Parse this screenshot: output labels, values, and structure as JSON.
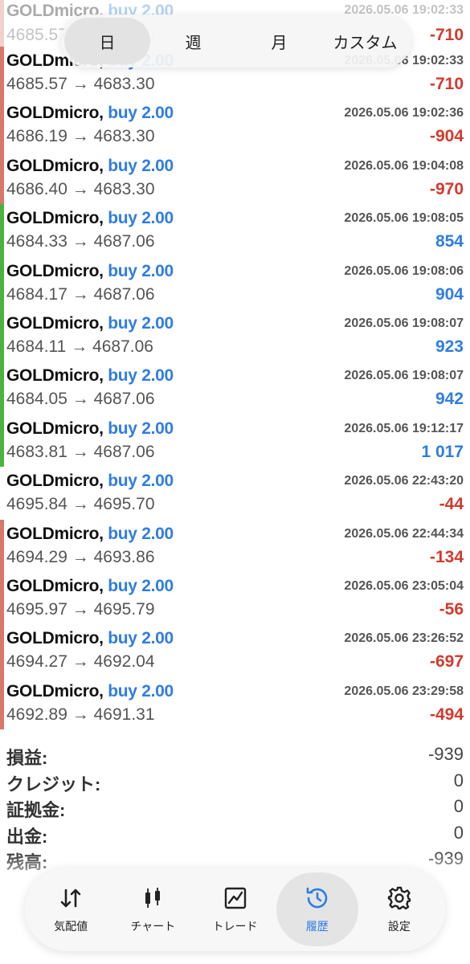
{
  "period_tabs": [
    {
      "label": "日",
      "active": true
    },
    {
      "label": "週",
      "active": false
    },
    {
      "label": "月",
      "active": false
    },
    {
      "label": "カスタム",
      "active": false
    }
  ],
  "deals": [
    {
      "symbol": "GOLDmicro,",
      "side": "buy 2.00",
      "time": "2026.05.06 19:02:33",
      "open": "4685.57",
      "arrow": "→",
      "close": "4683.30",
      "profit": "-710",
      "sign": "neg",
      "bar_color": "#d9776c"
    },
    {
      "symbol": "GOLDmicro,",
      "side": "buy 2.00",
      "time": "2026.05.06 19:02:33",
      "open": "4685.57",
      "arrow": "→",
      "close": "4683.30",
      "profit": "-710",
      "sign": "neg",
      "bar_color": "#d9776c"
    },
    {
      "symbol": "GOLDmicro,",
      "side": "buy 2.00",
      "time": "2026.05.06 19:02:36",
      "open": "4686.19",
      "arrow": "→",
      "close": "4683.30",
      "profit": "-904",
      "sign": "neg",
      "bar_color": "#d9776c"
    },
    {
      "symbol": "GOLDmicro,",
      "side": "buy 2.00",
      "time": "2026.05.06 19:04:08",
      "open": "4686.40",
      "arrow": "→",
      "close": "4683.30",
      "profit": "-970",
      "sign": "neg",
      "bar_color": "#d9776c"
    },
    {
      "symbol": "GOLDmicro,",
      "side": "buy 2.00",
      "time": "2026.05.06 19:08:05",
      "open": "4684.33",
      "arrow": "→",
      "close": "4687.06",
      "profit": "854",
      "sign": "pos",
      "bar_color": "#49b43c"
    },
    {
      "symbol": "GOLDmicro,",
      "side": "buy 2.00",
      "time": "2026.05.06 19:08:06",
      "open": "4684.17",
      "arrow": "→",
      "close": "4687.06",
      "profit": "904",
      "sign": "pos",
      "bar_color": "#49b43c"
    },
    {
      "symbol": "GOLDmicro,",
      "side": "buy 2.00",
      "time": "2026.05.06 19:08:07",
      "open": "4684.11",
      "arrow": "→",
      "close": "4687.06",
      "profit": "923",
      "sign": "pos",
      "bar_color": "#49b43c"
    },
    {
      "symbol": "GOLDmicro,",
      "side": "buy 2.00",
      "time": "2026.05.06 19:08:07",
      "open": "4684.05",
      "arrow": "→",
      "close": "4687.06",
      "profit": "942",
      "sign": "pos",
      "bar_color": "#49b43c"
    },
    {
      "symbol": "GOLDmicro,",
      "side": "buy 2.00",
      "time": "2026.05.06 19:12:17",
      "open": "4683.81",
      "arrow": "→",
      "close": "4687.06",
      "profit": "1 017",
      "sign": "pos",
      "bar_color": "#49b43c"
    },
    {
      "symbol": "GOLDmicro,",
      "side": "buy 2.00",
      "time": "2026.05.06 22:43:20",
      "open": "4695.84",
      "arrow": "→",
      "close": "4695.70",
      "profit": "-44",
      "sign": "neg",
      "bar_color": "#ffffff"
    },
    {
      "symbol": "GOLDmicro,",
      "side": "buy 2.00",
      "time": "2026.05.06 22:44:34",
      "open": "4694.29",
      "arrow": "→",
      "close": "4693.86",
      "profit": "-134",
      "sign": "neg",
      "bar_color": "#d9776c"
    },
    {
      "symbol": "GOLDmicro,",
      "side": "buy 2.00",
      "time": "2026.05.06 23:05:04",
      "open": "4695.97",
      "arrow": "→",
      "close": "4695.79",
      "profit": "-56",
      "sign": "neg",
      "bar_color": "#d9776c"
    },
    {
      "symbol": "GOLDmicro,",
      "side": "buy 2.00",
      "time": "2026.05.06 23:26:52",
      "open": "4694.27",
      "arrow": "→",
      "close": "4692.04",
      "profit": "-697",
      "sign": "neg",
      "bar_color": "#d9776c"
    },
    {
      "symbol": "GOLDmicro,",
      "side": "buy 2.00",
      "time": "2026.05.06 23:29:58",
      "open": "4692.89",
      "arrow": "→",
      "close": "4691.31",
      "profit": "-494",
      "sign": "neg",
      "bar_color": "#d9776c"
    }
  ],
  "summary": [
    {
      "label": "損益:",
      "value": "-939"
    },
    {
      "label": "クレジット:",
      "value": "0"
    },
    {
      "label": "証拠金:",
      "value": "0"
    },
    {
      "label": "出金:",
      "value": "0"
    },
    {
      "label": "残高:",
      "value": "-939"
    }
  ],
  "nav": [
    {
      "label": "気配値",
      "icon": "quotes-icon",
      "active": false
    },
    {
      "label": "チャート",
      "icon": "chart-candles-icon",
      "active": false
    },
    {
      "label": "トレード",
      "icon": "trade-icon",
      "active": false
    },
    {
      "label": "履歴",
      "icon": "history-icon",
      "active": true
    },
    {
      "label": "設定",
      "icon": "gear-icon",
      "active": false
    }
  ],
  "colors": {
    "profit_positive": "#2f7de1",
    "profit_negative": "#d23a2c",
    "accent": "#2f7de1"
  }
}
